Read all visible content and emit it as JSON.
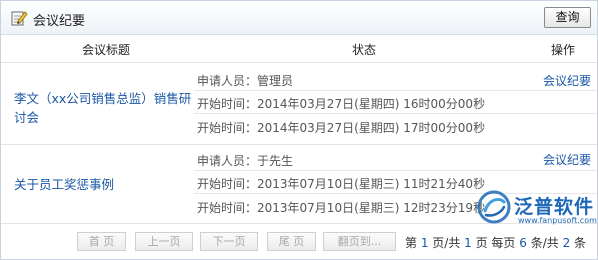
{
  "header": {
    "title": "会议纪要",
    "query_label": "查询"
  },
  "columns": {
    "title": "会议标题",
    "status": "状态",
    "operation": "操作"
  },
  "records": [
    {
      "title": "李文（xx公司销售总监）销售研讨会",
      "applicant": "申请人员：管理员",
      "start1": "开始时间：2014年03月27日(星期四) 16时00分00秒",
      "start2": "开始时间：2014年03月27日(星期四) 17时00分00秒",
      "link": "会议纪要"
    },
    {
      "title": "关于员工奖惩事例",
      "applicant": "申请人员：于先生",
      "start1": "开始时间：2013年07月10日(星期三) 11时21分40秒",
      "start2": "开始时间：2013年07月10日(星期三) 12时23分19秒",
      "link": "会议纪要"
    }
  ],
  "pager": {
    "first": "首 页",
    "prev": "上一页",
    "next": "下一页",
    "last": "尾 页",
    "goto": "翻页到...",
    "text_a": "第 ",
    "current": "1",
    "text_b": " 页/共 ",
    "total_pages": "1",
    "text_c": " 页 每页 ",
    "per_page": "6",
    "text_d": " 条/共 ",
    "total_items": "2",
    "text_e": " 条"
  },
  "watermark": {
    "brand": "泛普软件",
    "url": "www.fanpusoft.com"
  },
  "colors": {
    "link": "#1a56a6",
    "brand": "#1e68b8"
  }
}
